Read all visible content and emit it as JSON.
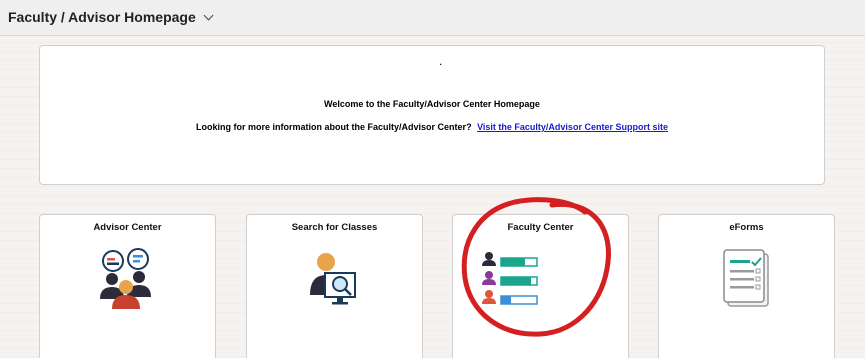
{
  "header": {
    "title": "Faculty / Advisor Homepage"
  },
  "welcome": {
    "dot": ".",
    "title": "Welcome to the Faculty/Advisor Center Homepage",
    "info_text": "Looking for more information about the Faculty/Advisor Center?",
    "info_link": "Visit the Faculty/Advisor Center Support site"
  },
  "tiles": [
    {
      "label": "Advisor Center",
      "icon": "advisor-people-icon"
    },
    {
      "label": "Search for Classes",
      "icon": "search-person-icon"
    },
    {
      "label": "Faculty Center",
      "icon": "faculty-roster-icon"
    },
    {
      "label": "eForms",
      "icon": "eform-document-icon"
    }
  ],
  "colors": {
    "link": "#1a1ad4",
    "annotation": "#d42020",
    "teal": "#1aa68c"
  }
}
